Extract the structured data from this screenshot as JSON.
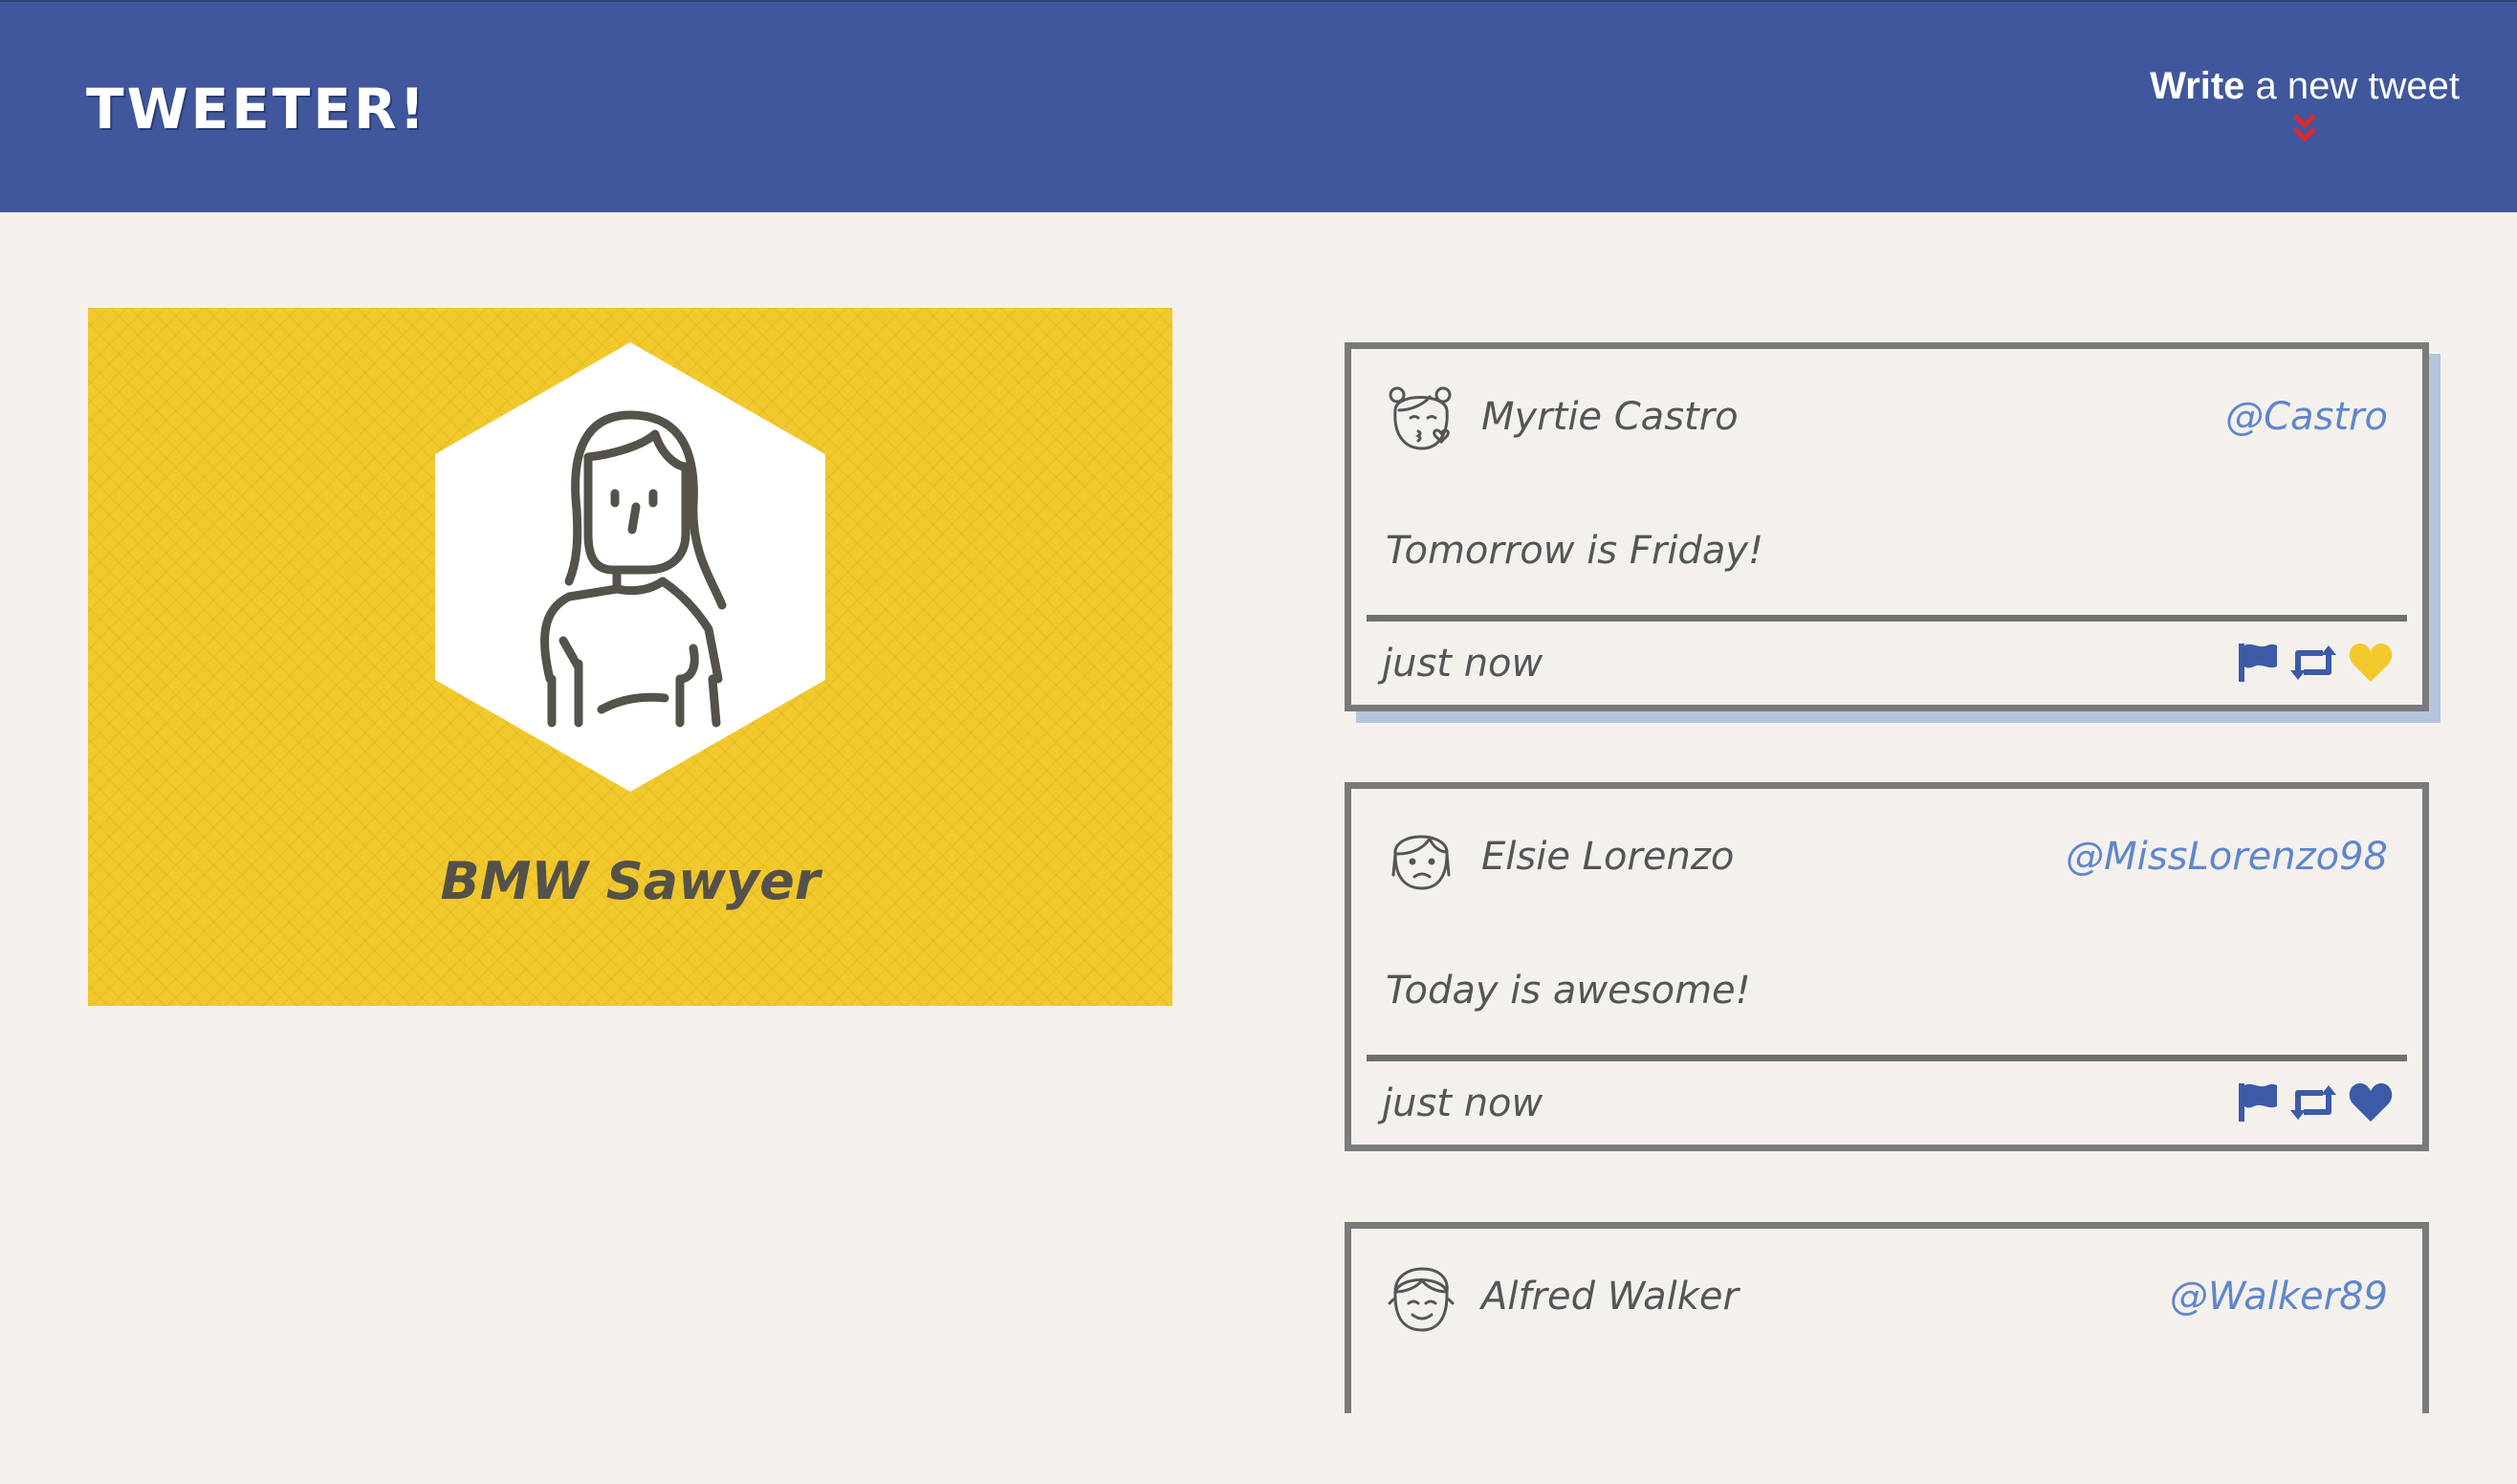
{
  "nav": {
    "brand": "TWEETER!",
    "compose_strong": "Write",
    "compose_rest": "a new tweet",
    "compose_arrow_icon": "double-chevron-down-icon",
    "colors": {
      "bar": "#40579d",
      "arrow": "#e0272f"
    }
  },
  "profile": {
    "name": "BMW Sawyer",
    "avatar_icon": "woman-avatar-icon",
    "colors": {
      "card": "#f2c92d",
      "hex": "#ffffff"
    }
  },
  "tweets": [
    {
      "name": "Myrtie Castro",
      "handle": "@Castro",
      "text": "Tomorrow is Friday!",
      "time": "just now",
      "avatar_icon": "girl-kiss-avatar-icon",
      "liked": true
    },
    {
      "name": "Elsie Lorenzo",
      "handle": "@MissLorenzo98",
      "text": "Today is awesome!",
      "time": "just now",
      "avatar_icon": "girl-sad-avatar-icon",
      "liked": false
    },
    {
      "name": "Alfred Walker",
      "handle": "@Walker89",
      "avatar_icon": "boy-avatar-icon"
    }
  ],
  "action_icons": [
    "flag-icon",
    "retweet-icon",
    "heart-icon"
  ],
  "colors": {
    "action": "#3d5aa6",
    "liked": "#f2c92d",
    "handle": "#5f86cc"
  }
}
